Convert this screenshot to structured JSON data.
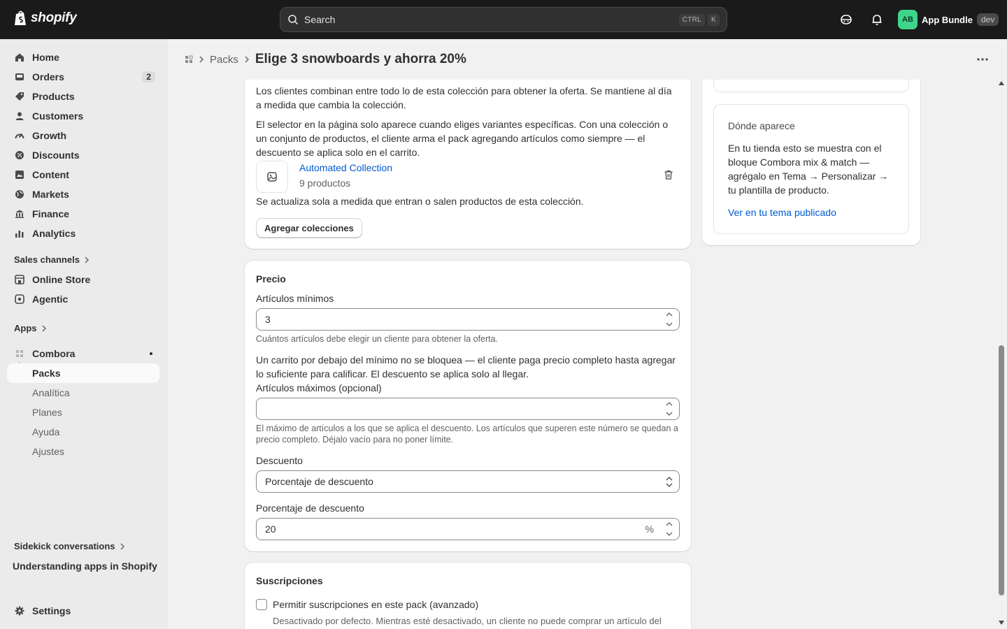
{
  "topbar": {
    "brand": "shopify",
    "search_placeholder": "Search",
    "shortcut_ctrl": "CTRL",
    "shortcut_k": "K",
    "store_initials": "AB",
    "store_name": "App Bundle",
    "store_badge": "dev"
  },
  "sidebar": {
    "items": [
      {
        "label": "Home",
        "icon": "home-icon"
      },
      {
        "label": "Orders",
        "icon": "inbox-icon",
        "count": "2"
      },
      {
        "label": "Products",
        "icon": "tag-icon"
      },
      {
        "label": "Customers",
        "icon": "person-icon"
      },
      {
        "label": "Growth",
        "icon": "gauge-icon"
      },
      {
        "label": "Discounts",
        "icon": "discount-icon"
      },
      {
        "label": "Content",
        "icon": "content-icon"
      },
      {
        "label": "Markets",
        "icon": "globe-icon"
      },
      {
        "label": "Finance",
        "icon": "bank-icon"
      },
      {
        "label": "Analytics",
        "icon": "chart-icon"
      }
    ],
    "sales_channels_label": "Sales channels",
    "channels": [
      {
        "label": "Online Store",
        "icon": "store-icon"
      },
      {
        "label": "Agentic",
        "icon": "agentic-icon"
      }
    ],
    "apps_label": "Apps",
    "app_name": "Combora",
    "app_subitems": [
      "Packs",
      "Analítica",
      "Planes",
      "Ayuda",
      "Ajustes"
    ],
    "sidekick_label": "Sidekick conversations",
    "sidekick_item": "Understanding apps in Shopify",
    "settings_label": "Settings"
  },
  "header": {
    "breadcrumb": "Packs",
    "title": "Elige 3 snowboards y ahorra 20%"
  },
  "collection_card": {
    "text1": "Los clientes combinan entre todo lo de esta colección para obtener la oferta. Se mantiene al día a medida que cambia la colección.",
    "text2": "El selector en la página solo aparece cuando eliges variantes específicas. Con una colección o un conjunto de productos, el cliente arma el pack agregando artículos como siempre — el descuento se aplica solo en el carrito.",
    "collection_name": "Automated Collection",
    "collection_count": "9 productos",
    "note": "Se actualiza sola a medida que entran o salen productos de esta colección.",
    "add_button": "Agregar colecciones"
  },
  "price_card": {
    "title": "Precio",
    "min_label": "Artículos mínimos",
    "min_value": "3",
    "min_help": "Cuántos artículos debe elegir un cliente para obtener la oferta.",
    "min_note": "Un carrito por debajo del mínimo no se bloquea — el cliente paga precio completo hasta agregar lo suficiente para calificar. El descuento se aplica solo al llegar.",
    "max_label": "Artículos máximos (opcional)",
    "max_value": "",
    "max_help": "El máximo de artículos a los que se aplica el descuento. Los artículos que superen este número se quedan a precio completo. Déjalo vacío para no poner límite.",
    "discount_label": "Descuento",
    "discount_value": "Porcentaje de descuento",
    "percent_label": "Porcentaje de descuento",
    "percent_value": "20",
    "percent_suffix": "%"
  },
  "subscriptions_card": {
    "title": "Suscripciones",
    "checkbox_label": "Permitir suscripciones en este pack (avanzado)",
    "checked": false,
    "help": "Desactivado por defecto. Mientras esté desactivado, un cliente no puede comprar un artículo del"
  },
  "where_card": {
    "title": "Dónde aparece",
    "text": "En tu tienda esto se muestra con el bloque Combora mix & match — agrégalo en Tema → Personalizar → tu plantilla de producto.",
    "link": "Ver en tu tema publicado"
  },
  "colors": {
    "topbar": "#1a1a1a",
    "sidebar": "#ebebeb",
    "link": "#005bd3",
    "avatar": "#3ed48a"
  }
}
